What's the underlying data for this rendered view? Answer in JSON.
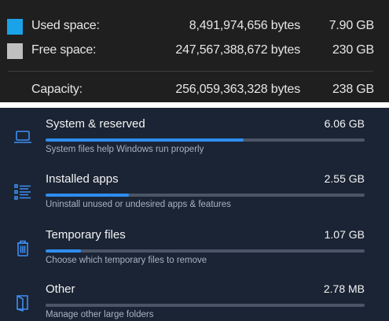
{
  "disk": {
    "rows": [
      {
        "label": "Used space:",
        "bytes": "8,491,974,656 bytes",
        "gb": "7.90 GB",
        "color": "#1aa3e8"
      },
      {
        "label": "Free space:",
        "bytes": "247,567,388,672 bytes",
        "gb": "230 GB",
        "color": "#bfbfbf"
      }
    ],
    "capacity": {
      "label": "Capacity:",
      "bytes": "256,059,363,328 bytes",
      "gb": "238 GB"
    }
  },
  "storage": {
    "accent": "#2f8df0",
    "categories": [
      {
        "icon": "laptop-icon",
        "title": "System & reserved",
        "size": "6.06 GB",
        "description": "System files help Windows run properly",
        "fill": 0.62
      },
      {
        "icon": "apps-list-icon",
        "title": "Installed apps",
        "size": "2.55 GB",
        "description": "Uninstall unused or undesired apps & features",
        "fill": 0.26
      },
      {
        "icon": "trash-icon",
        "title": "Temporary files",
        "size": "1.07 GB",
        "description": "Choose which temporary files to remove",
        "fill": 0.11
      },
      {
        "icon": "folder-icon",
        "title": "Other",
        "size": "2.78 MB",
        "description": "Manage other large folders",
        "fill": 0.0
      }
    ]
  }
}
